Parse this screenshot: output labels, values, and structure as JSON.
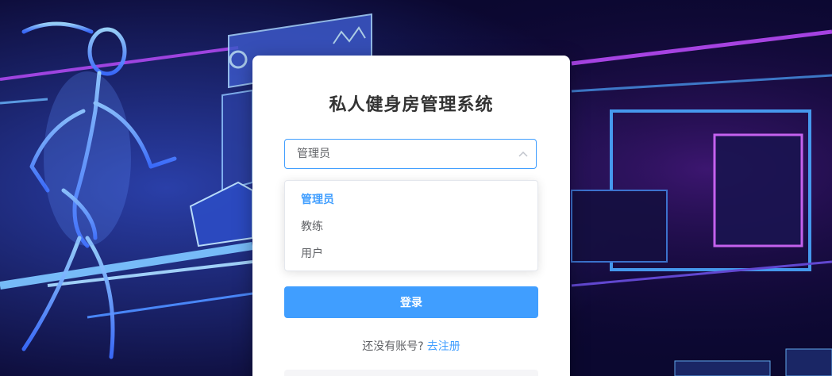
{
  "login": {
    "title": "私人健身房管理系统",
    "role_select": {
      "value": "管理员",
      "options": [
        "管理员",
        "教练",
        "用户"
      ]
    },
    "login_button": "登录",
    "register_prompt": "还没有账号?",
    "register_link": "去注册"
  },
  "colors": {
    "accent": "#409eff",
    "title_text": "#333333",
    "body_text": "#606266",
    "background_dark": "#0b0830"
  },
  "icons": {
    "select_arrow": "chevron-up-icon"
  }
}
